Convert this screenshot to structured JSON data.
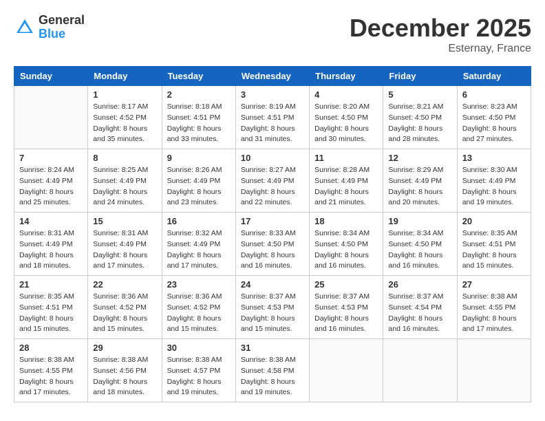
{
  "header": {
    "logo_general": "General",
    "logo_blue": "Blue",
    "month_title": "December 2025",
    "location": "Esternay, France"
  },
  "weekdays": [
    "Sunday",
    "Monday",
    "Tuesday",
    "Wednesday",
    "Thursday",
    "Friday",
    "Saturday"
  ],
  "weeks": [
    [
      {
        "day": "",
        "sunrise": "",
        "sunset": "",
        "daylight": ""
      },
      {
        "day": "1",
        "sunrise": "Sunrise: 8:17 AM",
        "sunset": "Sunset: 4:52 PM",
        "daylight": "Daylight: 8 hours and 35 minutes."
      },
      {
        "day": "2",
        "sunrise": "Sunrise: 8:18 AM",
        "sunset": "Sunset: 4:51 PM",
        "daylight": "Daylight: 8 hours and 33 minutes."
      },
      {
        "day": "3",
        "sunrise": "Sunrise: 8:19 AM",
        "sunset": "Sunset: 4:51 PM",
        "daylight": "Daylight: 8 hours and 31 minutes."
      },
      {
        "day": "4",
        "sunrise": "Sunrise: 8:20 AM",
        "sunset": "Sunset: 4:50 PM",
        "daylight": "Daylight: 8 hours and 30 minutes."
      },
      {
        "day": "5",
        "sunrise": "Sunrise: 8:21 AM",
        "sunset": "Sunset: 4:50 PM",
        "daylight": "Daylight: 8 hours and 28 minutes."
      },
      {
        "day": "6",
        "sunrise": "Sunrise: 8:23 AM",
        "sunset": "Sunset: 4:50 PM",
        "daylight": "Daylight: 8 hours and 27 minutes."
      }
    ],
    [
      {
        "day": "7",
        "sunrise": "Sunrise: 8:24 AM",
        "sunset": "Sunset: 4:49 PM",
        "daylight": "Daylight: 8 hours and 25 minutes."
      },
      {
        "day": "8",
        "sunrise": "Sunrise: 8:25 AM",
        "sunset": "Sunset: 4:49 PM",
        "daylight": "Daylight: 8 hours and 24 minutes."
      },
      {
        "day": "9",
        "sunrise": "Sunrise: 8:26 AM",
        "sunset": "Sunset: 4:49 PM",
        "daylight": "Daylight: 8 hours and 23 minutes."
      },
      {
        "day": "10",
        "sunrise": "Sunrise: 8:27 AM",
        "sunset": "Sunset: 4:49 PM",
        "daylight": "Daylight: 8 hours and 22 minutes."
      },
      {
        "day": "11",
        "sunrise": "Sunrise: 8:28 AM",
        "sunset": "Sunset: 4:49 PM",
        "daylight": "Daylight: 8 hours and 21 minutes."
      },
      {
        "day": "12",
        "sunrise": "Sunrise: 8:29 AM",
        "sunset": "Sunset: 4:49 PM",
        "daylight": "Daylight: 8 hours and 20 minutes."
      },
      {
        "day": "13",
        "sunrise": "Sunrise: 8:30 AM",
        "sunset": "Sunset: 4:49 PM",
        "daylight": "Daylight: 8 hours and 19 minutes."
      }
    ],
    [
      {
        "day": "14",
        "sunrise": "Sunrise: 8:31 AM",
        "sunset": "Sunset: 4:49 PM",
        "daylight": "Daylight: 8 hours and 18 minutes."
      },
      {
        "day": "15",
        "sunrise": "Sunrise: 8:31 AM",
        "sunset": "Sunset: 4:49 PM",
        "daylight": "Daylight: 8 hours and 17 minutes."
      },
      {
        "day": "16",
        "sunrise": "Sunrise: 8:32 AM",
        "sunset": "Sunset: 4:49 PM",
        "daylight": "Daylight: 8 hours and 17 minutes."
      },
      {
        "day": "17",
        "sunrise": "Sunrise: 8:33 AM",
        "sunset": "Sunset: 4:50 PM",
        "daylight": "Daylight: 8 hours and 16 minutes."
      },
      {
        "day": "18",
        "sunrise": "Sunrise: 8:34 AM",
        "sunset": "Sunset: 4:50 PM",
        "daylight": "Daylight: 8 hours and 16 minutes."
      },
      {
        "day": "19",
        "sunrise": "Sunrise: 8:34 AM",
        "sunset": "Sunset: 4:50 PM",
        "daylight": "Daylight: 8 hours and 16 minutes."
      },
      {
        "day": "20",
        "sunrise": "Sunrise: 8:35 AM",
        "sunset": "Sunset: 4:51 PM",
        "daylight": "Daylight: 8 hours and 15 minutes."
      }
    ],
    [
      {
        "day": "21",
        "sunrise": "Sunrise: 8:35 AM",
        "sunset": "Sunset: 4:51 PM",
        "daylight": "Daylight: 8 hours and 15 minutes."
      },
      {
        "day": "22",
        "sunrise": "Sunrise: 8:36 AM",
        "sunset": "Sunset: 4:52 PM",
        "daylight": "Daylight: 8 hours and 15 minutes."
      },
      {
        "day": "23",
        "sunrise": "Sunrise: 8:36 AM",
        "sunset": "Sunset: 4:52 PM",
        "daylight": "Daylight: 8 hours and 15 minutes."
      },
      {
        "day": "24",
        "sunrise": "Sunrise: 8:37 AM",
        "sunset": "Sunset: 4:53 PM",
        "daylight": "Daylight: 8 hours and 15 minutes."
      },
      {
        "day": "25",
        "sunrise": "Sunrise: 8:37 AM",
        "sunset": "Sunset: 4:53 PM",
        "daylight": "Daylight: 8 hours and 16 minutes."
      },
      {
        "day": "26",
        "sunrise": "Sunrise: 8:37 AM",
        "sunset": "Sunset: 4:54 PM",
        "daylight": "Daylight: 8 hours and 16 minutes."
      },
      {
        "day": "27",
        "sunrise": "Sunrise: 8:38 AM",
        "sunset": "Sunset: 4:55 PM",
        "daylight": "Daylight: 8 hours and 17 minutes."
      }
    ],
    [
      {
        "day": "28",
        "sunrise": "Sunrise: 8:38 AM",
        "sunset": "Sunset: 4:55 PM",
        "daylight": "Daylight: 8 hours and 17 minutes."
      },
      {
        "day": "29",
        "sunrise": "Sunrise: 8:38 AM",
        "sunset": "Sunset: 4:56 PM",
        "daylight": "Daylight: 8 hours and 18 minutes."
      },
      {
        "day": "30",
        "sunrise": "Sunrise: 8:38 AM",
        "sunset": "Sunset: 4:57 PM",
        "daylight": "Daylight: 8 hours and 19 minutes."
      },
      {
        "day": "31",
        "sunrise": "Sunrise: 8:38 AM",
        "sunset": "Sunset: 4:58 PM",
        "daylight": "Daylight: 8 hours and 19 minutes."
      },
      {
        "day": "",
        "sunrise": "",
        "sunset": "",
        "daylight": ""
      },
      {
        "day": "",
        "sunrise": "",
        "sunset": "",
        "daylight": ""
      },
      {
        "day": "",
        "sunrise": "",
        "sunset": "",
        "daylight": ""
      }
    ]
  ]
}
